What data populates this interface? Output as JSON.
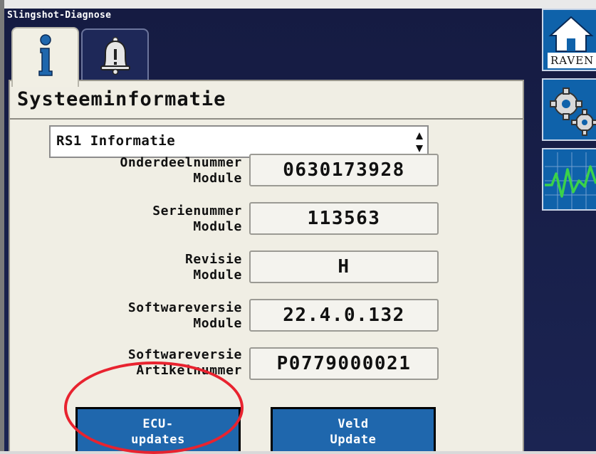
{
  "app": {
    "title": "Slingshot-Diagnose"
  },
  "tabs": [
    {
      "name": "info",
      "icon": "info-icon",
      "active": true
    },
    {
      "name": "alarm",
      "icon": "alarm-bell-icon",
      "active": false
    }
  ],
  "panel": {
    "title": "Systeeminformatie"
  },
  "dropdown": {
    "selected": "RS1 Informatie"
  },
  "fields": [
    {
      "label_line1": "Onderdeelnummer",
      "label_line2": "Module",
      "value": "0630173928"
    },
    {
      "label_line1": "Serienummer",
      "label_line2": "Module",
      "value": "113563"
    },
    {
      "label_line1": "Revisie",
      "label_line2": "Module",
      "value": "H"
    },
    {
      "label_line1": "Softwareversie",
      "label_line2": "Module",
      "value": "22.4.0.132"
    },
    {
      "label_line1": "Softwareversie",
      "label_line2": "Artikelnummer",
      "value": "P0779000021"
    }
  ],
  "buttons": {
    "ecu_line1": "ECU-",
    "ecu_line2": "updates",
    "field_line1": "Veld",
    "field_line2": "Update"
  },
  "sidebar": {
    "home_label": "RAVEN",
    "items": [
      "home-icon",
      "gears-icon",
      "diagnostics-pulse-icon"
    ]
  },
  "colors": {
    "screen_bg": "#151b42",
    "panel_bg": "#f0eee4",
    "button_blue": "#1f67ad",
    "highlight_red": "#e8232f"
  }
}
